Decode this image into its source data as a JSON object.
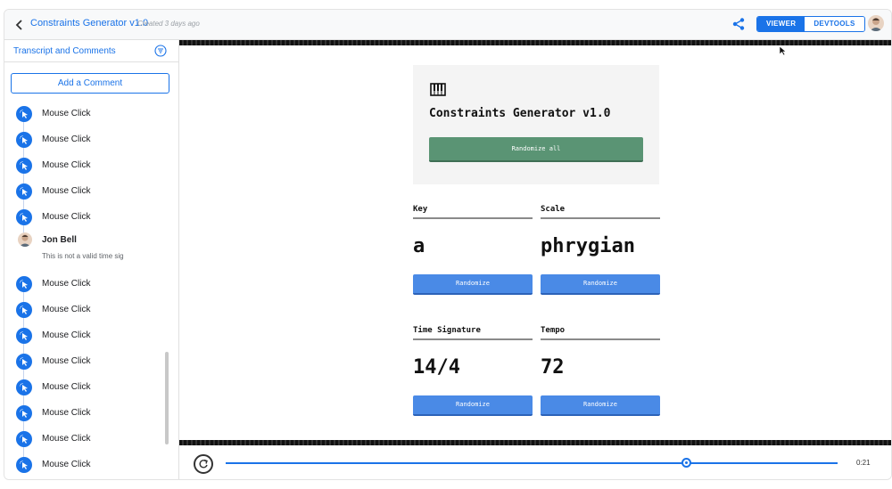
{
  "header": {
    "title": "Constraints Generator v1.0",
    "created": "Created 3 days ago",
    "viewer_label": "VIEWER",
    "devtools_label": "DEVTOOLS"
  },
  "sidebar": {
    "heading": "Transcript and Comments",
    "add_comment": "Add a Comment",
    "events_before": [
      "Mouse Click",
      "Mouse Click",
      "Mouse Click",
      "Mouse Click",
      "Mouse Click"
    ],
    "comment": {
      "author": "Jon Bell",
      "text": "This is not a valid time sig"
    },
    "events_after": [
      "Mouse Click",
      "Mouse Click",
      "Mouse Click",
      "Mouse Click",
      "Mouse Click",
      "Mouse Click",
      "Mouse Click",
      "Mouse Click"
    ]
  },
  "app": {
    "title": "Constraints Generator v1.0",
    "randomize_all": "Randomize all",
    "fields": [
      {
        "label": "Key",
        "value": "a",
        "button": "Randomize"
      },
      {
        "label": "Scale",
        "value": "phrygian",
        "button": "Randomize"
      },
      {
        "label": "Time Signature",
        "value": "14/4",
        "button": "Randomize"
      },
      {
        "label": "Tempo",
        "value": "72",
        "button": "Randomize"
      }
    ]
  },
  "player": {
    "time": "0:21",
    "progress_fraction": 0.75
  },
  "colors": {
    "accent": "#1a73e8",
    "green_button": "#5a9474",
    "blue_button": "#4a8ae6"
  },
  "icons": [
    "back-arrow-icon",
    "share-icon",
    "avatar",
    "filter-icon",
    "mouse-click-icon",
    "piano-icon",
    "replay-icon",
    "cursor-icon"
  ]
}
